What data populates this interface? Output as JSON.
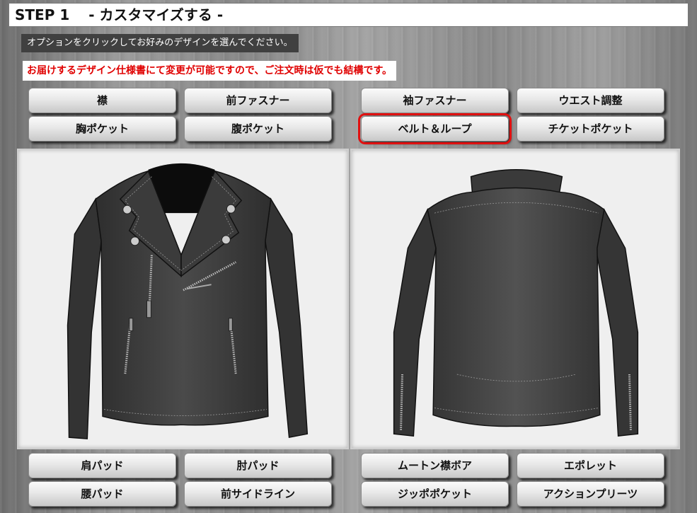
{
  "header": {
    "title": "STEP 1 　- カスタマイズする -"
  },
  "instruction": "オプションをクリックしてお好みのデザインを選んでください。",
  "notice": "お届けするデザイン仕様書にて変更が可能ですので、ご注文時は仮でも結構です。",
  "top_options": [
    {
      "label": "襟"
    },
    {
      "label": "前ファスナー"
    },
    {
      "label": "袖ファスナー"
    },
    {
      "label": "ウエスト調整"
    },
    {
      "label": "胸ポケット"
    },
    {
      "label": "腹ポケット"
    },
    {
      "label": "ベルト＆ループ",
      "selected": true
    },
    {
      "label": "チケットポケット"
    }
  ],
  "bottom_options": [
    {
      "label": "肩パッド"
    },
    {
      "label": "肘パッド"
    },
    {
      "label": "ムートン襟ボア"
    },
    {
      "label": "エポレット"
    },
    {
      "label": "腰パッド"
    },
    {
      "label": "前サイドライン"
    },
    {
      "label": "ジッポポケット"
    },
    {
      "label": "アクションプリーツ"
    }
  ],
  "colors": {
    "accent_selected": "#e01010",
    "notice_text": "#e00000",
    "jacket": "#3a3a3a"
  }
}
